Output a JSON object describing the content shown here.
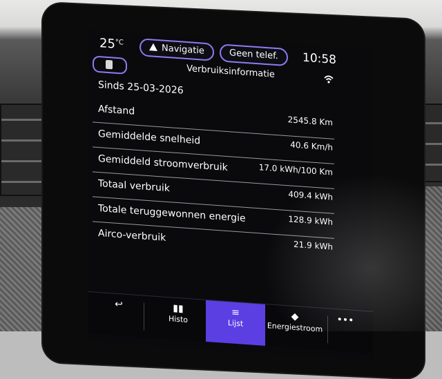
{
  "status_bar": {
    "temperature": "25",
    "temperature_unit": "°C",
    "nav_button": "Navigatie",
    "phone_button": "Geen telef.",
    "time": "10:58"
  },
  "header": {
    "title": "Verbruiksinformatie",
    "phone_icon": "phone-icon",
    "signal_icon": "connection-icon"
  },
  "since_label": "Sinds 25-03-2026",
  "rows": [
    {
      "label": "Afstand",
      "value": "2545.8 Km"
    },
    {
      "label": "Gemiddelde snelheid",
      "value": "40.6 Km/h"
    },
    {
      "label": "Gemiddeld stroomverbruik",
      "value": "17.0 kWh/100 Km"
    },
    {
      "label": "Totaal verbruik",
      "value": "409.4 kWh"
    },
    {
      "label": "Totale teruggewonnen energie",
      "value": "128.9 kWh"
    },
    {
      "label": "Airco-verbruik",
      "value": "21.9 kWh"
    }
  ],
  "bottom_nav": {
    "histo": "Histo",
    "lijst": "Lijst",
    "energie": "Energiestroom",
    "active_color": "#5b3fe3"
  },
  "colors": {
    "accent_outline": "#8f7cf0",
    "screen_bg": "#0a0a0d"
  }
}
